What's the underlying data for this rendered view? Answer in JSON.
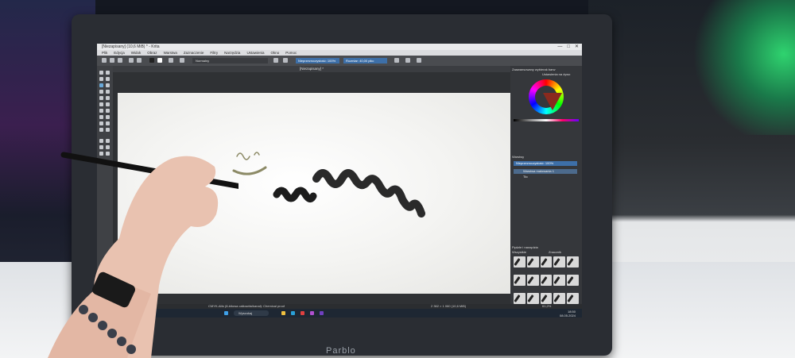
{
  "window": {
    "title": "[Niezapisany] (10,6 MiB) * - Krita",
    "controls": [
      "—",
      "□",
      "✕"
    ]
  },
  "menu": [
    "Plik",
    "Edycja",
    "Widok",
    "Obraz",
    "Warstwa",
    "Zaznaczenie",
    "Filtry",
    "Narzędzia",
    "Ustawienia",
    "Okno",
    "Pomoc"
  ],
  "toolbar": {
    "blend_mode": "Normalny",
    "opacity": "Nieprzezroczystość: 100%",
    "size": "Rozmiar: 40,00 pikc"
  },
  "document_tab": "[Niezapisany] *",
  "dockers": {
    "color_tab_1": "Zaawansowany wybierak barw",
    "color_tab_2": "Ustawienia na żywo",
    "layers_title": "Warstwy",
    "layer_opacity": "Nieprzezroczystość: 100%",
    "layers": [
      {
        "name": "Warstwa malowania 1"
      },
      {
        "name": "Tło"
      }
    ],
    "brushes_title": "Pędzle i narzędzia",
    "brushes_tag": "Wszystkie",
    "brushes_search": "Znacznik"
  },
  "status": {
    "left": "CMYK-Alfa (8-bitowa całkowita/kanał): Chemical proof",
    "right": "2 362 × 1 060 (10,6 MiB)",
    "zoom": "61,2%"
  },
  "taskbar": {
    "search_placeholder": "Wyszukaj",
    "time": "18:50",
    "date": "08.05.2024"
  },
  "device_brand": "Parblo",
  "colors": {
    "accent": "#3d6fa8",
    "canvas": "#f4f4f2",
    "stroke": "#1c1c1c",
    "stroke_tint": "#8c8a66"
  }
}
